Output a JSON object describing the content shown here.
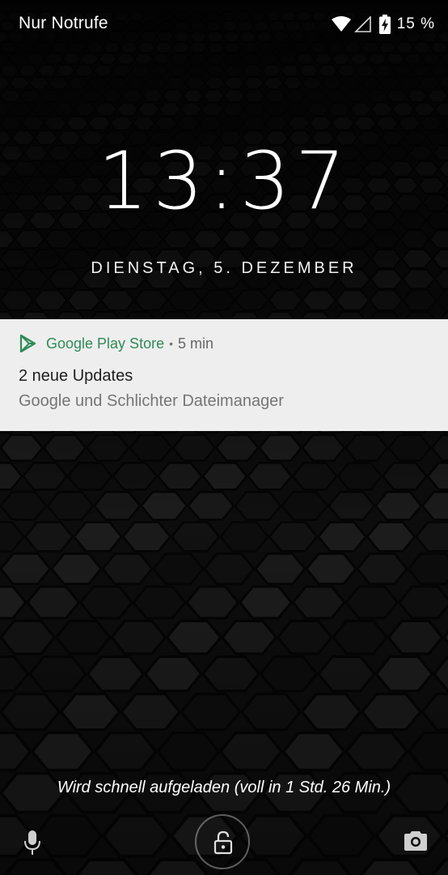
{
  "status_bar": {
    "carrier": "Nur Notrufe",
    "battery_percent": "15 %",
    "icons": [
      "wifi-icon",
      "cell-signal-icon",
      "battery-charging-icon"
    ]
  },
  "lockscreen": {
    "time": "13:37",
    "date": "DIENSTAG, 5. DEZEMBER",
    "charging_text": "Wird schnell aufgeladen (voll in 1 Std. 26 Min.)"
  },
  "notification": {
    "app_name": "Google Play Store",
    "separator": "•",
    "time_ago": "5 min",
    "title": "2 neue Updates",
    "text": "Google und Schlichter Dateimanager",
    "icon": "play-store-icon",
    "accent_color": "#2e8b57"
  },
  "bottom_actions": {
    "icons": [
      "microphone-icon",
      "unlock-icon",
      "camera-icon"
    ]
  },
  "colors": {
    "background": "#0b0b0b",
    "notification_bg": "#eeeeee"
  }
}
